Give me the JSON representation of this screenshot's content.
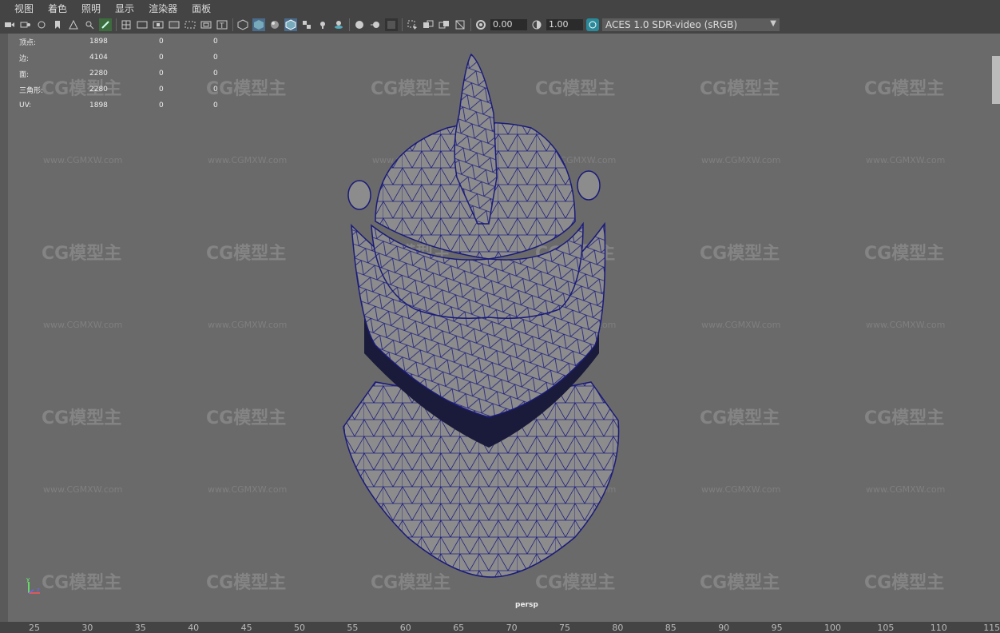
{
  "menu": [
    "视图",
    "着色",
    "照明",
    "显示",
    "渲染器",
    "面板"
  ],
  "toolbar": {
    "exposure": "0.00",
    "gamma": "1.00",
    "color_space": "ACES 1.0 SDR-video (sRGB)"
  },
  "hud": {
    "rows": [
      {
        "label": "顶点:",
        "v1": "1898",
        "v2": "0",
        "v3": "0"
      },
      {
        "label": "边:",
        "v1": "4104",
        "v2": "0",
        "v3": "0"
      },
      {
        "label": "面:",
        "v1": "2280",
        "v2": "0",
        "v3": "0"
      },
      {
        "label": "三角形:",
        "v1": "2280",
        "v2": "0",
        "v3": "0"
      },
      {
        "label": "UV:",
        "v1": "1898",
        "v2": "0",
        "v3": "0"
      }
    ]
  },
  "camera_label": "persp",
  "ruler": [
    "25",
    "30",
    "35",
    "40",
    "45",
    "50",
    "55",
    "60",
    "65",
    "70",
    "75",
    "80",
    "85",
    "90",
    "95",
    "100",
    "105",
    "110",
    "115"
  ],
  "watermark": {
    "logo": "CG模型主",
    "url": "www.CGMXW.com"
  },
  "colors": {
    "wire": "#1a1a7a",
    "mesh": "#8c8c8c",
    "viewport_bg": "#6a6a6a"
  }
}
